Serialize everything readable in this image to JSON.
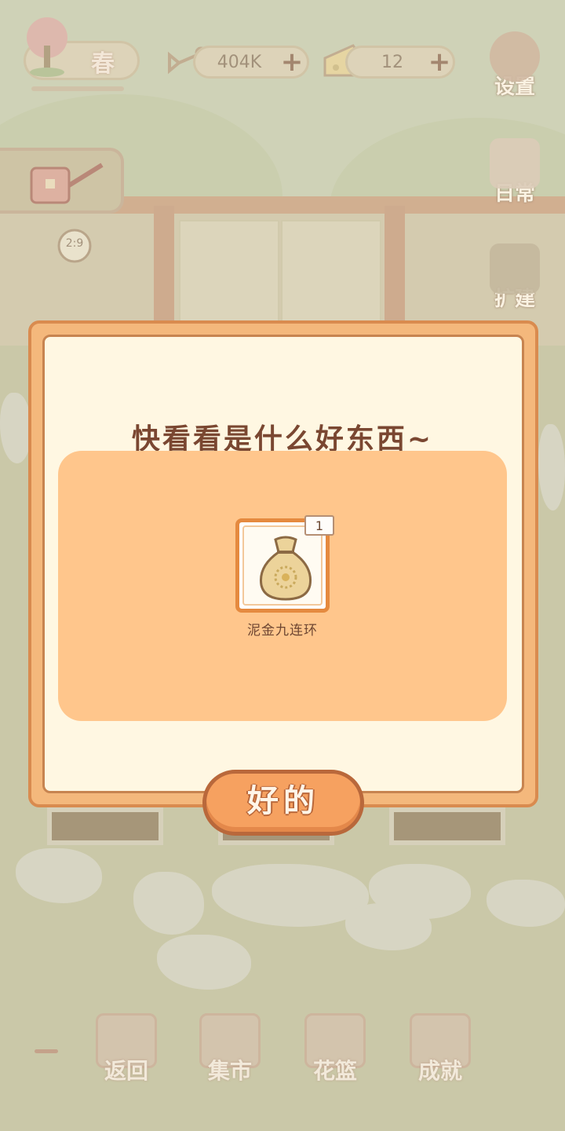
{
  "hud": {
    "season": "春",
    "fish_value": "404K",
    "cheese_value": "12",
    "plus": "+"
  },
  "side_menu": {
    "settings": "设置",
    "daily": "日常",
    "expand": "扩建"
  },
  "clock": {
    "time": "2:9"
  },
  "modal": {
    "title": "快看看是什么好东西~",
    "item": {
      "name": "泥金九连环",
      "count": "1",
      "icon": "money-bag-icon"
    },
    "ok_label": "好的"
  },
  "bottom_nav": {
    "back": "返回",
    "market": "集市",
    "basket": "花篮",
    "achievements": "成就"
  },
  "colors": {
    "modal_frame": "#f4b87c",
    "modal_inner": "#fff7e2",
    "reward_area": "#ffc68c",
    "title_text": "#7a4731",
    "ok_button": "#f6a160"
  }
}
